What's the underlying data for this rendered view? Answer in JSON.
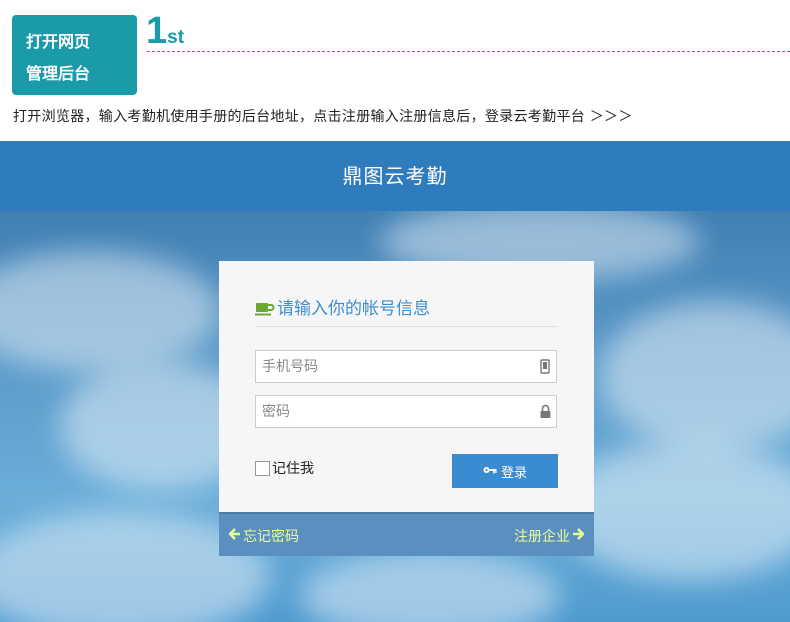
{
  "step": {
    "badge_line1": "打开网页",
    "badge_line2": "管理后台",
    "number": "1",
    "suffix": "st",
    "description": "打开浏览器，输入考勤机使用手册的后台地址，点击注册输入注册信息后，登录云考勤平台 ＞＞＞"
  },
  "app": {
    "title": "鼎图云考勤"
  },
  "login": {
    "heading": "请输入你的帐号信息",
    "phone_placeholder": "手机号码",
    "password_placeholder": "密码",
    "remember_label": "记住我",
    "login_button": "登录"
  },
  "footer": {
    "forgot_password": "忘记密码",
    "register_company": "注册企业"
  },
  "colors": {
    "teal_accent": "#1b9aa7",
    "header_blue": "#2f7cbd",
    "button_blue": "#3b8bd0",
    "footer_blue": "#5b8fbf",
    "link_green": "#e8ff9a",
    "cup_green": "#6aa832"
  },
  "icons": {
    "heading": "coffee-cup-icon",
    "phone": "mobile-phone-icon",
    "password": "lock-icon",
    "login": "key-icon",
    "forgot": "arrow-left-icon",
    "register": "arrow-right-icon"
  }
}
